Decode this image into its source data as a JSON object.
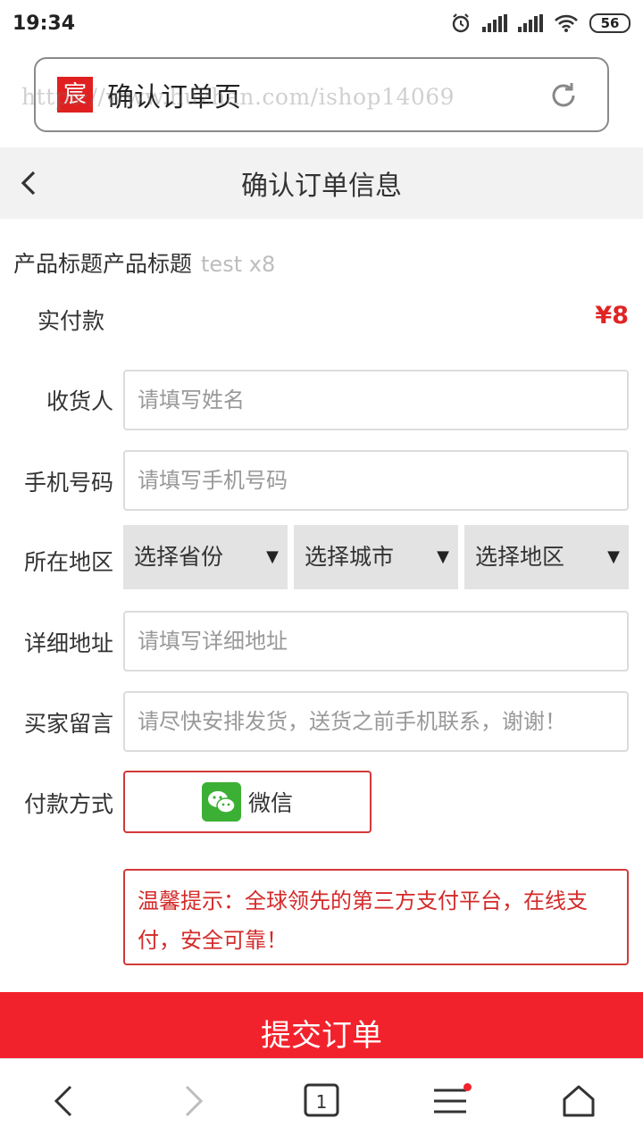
{
  "status_bar": {
    "time": "19:34",
    "battery": "56"
  },
  "browser": {
    "page_title": "确认订单页",
    "watermark": "https://www.huzhan.com/ishop14069",
    "logo_char": "宸"
  },
  "header": {
    "title": "确认订单信息"
  },
  "product": {
    "title": "产品标题产品标题",
    "qty": "test x8"
  },
  "payment": {
    "label": "实付款",
    "value": "¥8"
  },
  "form": {
    "receiver_label": "收货人",
    "receiver_placeholder": "请填写姓名",
    "phone_label": "手机号码",
    "phone_placeholder": "请填写手机号码",
    "region_label": "所在地区",
    "province": "选择省份",
    "city": "选择城市",
    "district": "选择地区",
    "address_label": "详细地址",
    "address_placeholder": "请填写详细地址",
    "message_label": "买家留言",
    "message_placeholder": "请尽快安排发货，送货之前手机联系，谢谢！",
    "paymethod_label": "付款方式",
    "paymethod_option": "微信"
  },
  "tip": "温馨提示：全球领先的第三方支付平台，在线支付，安全可靠！",
  "submit_label": "提交订单",
  "colors": {
    "accent": "#f2222c",
    "price": "#e02424",
    "wechat": "#3cb034"
  }
}
